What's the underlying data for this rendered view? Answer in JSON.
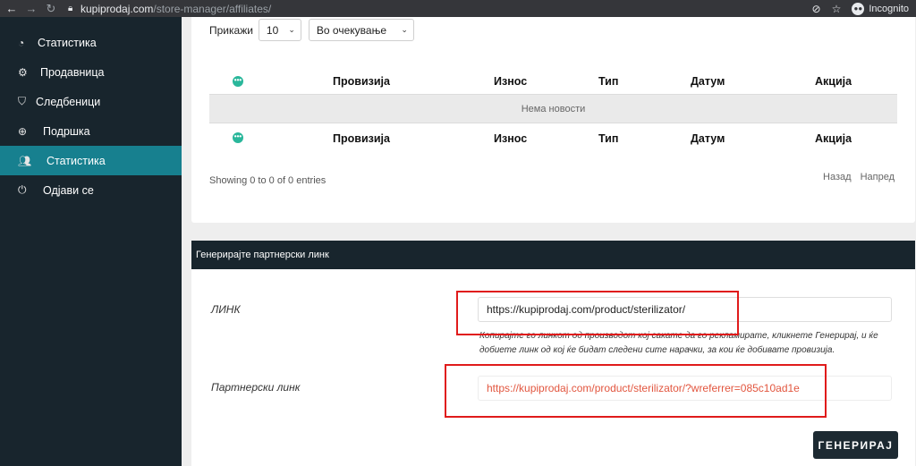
{
  "browser": {
    "url_host": "kupiprodaj.com",
    "url_path": "/store-manager/affiliates/",
    "incognito_label": "Incognito"
  },
  "sidebar": {
    "items": [
      {
        "label": "Статистика",
        "icon": "pie-chart-icon"
      },
      {
        "label": "Продавница",
        "icon": "gears-icon"
      },
      {
        "label": "Следбеници",
        "icon": "shirt-icon"
      },
      {
        "label": "Подршка",
        "icon": "lifebuoy-icon"
      },
      {
        "label": "Статистика",
        "icon": "users-icon",
        "active": true
      },
      {
        "label": "Одјави се",
        "icon": "power-icon"
      }
    ]
  },
  "table": {
    "show_label": "Прикажи",
    "page_size": "10",
    "filter_value": "Во очекување",
    "columns": [
      "Провизија",
      "Износ",
      "Тип",
      "Датум",
      "Акција"
    ],
    "empty_text": "Нема новости",
    "entries_text": "Showing 0 to 0 of 0 entries",
    "prev_label": "Назад",
    "next_label": "Напред"
  },
  "generator": {
    "title": "Генерирајте партнерски линк",
    "link_label": "ЛИНК",
    "link_value": "https://kupiprodaj.com/product/sterilizator/",
    "hint_text": "Копирајте го линкот од производот кој сакате да го рекламирате, кликнете Генерирај, и ќе добиете линк од кој ќе бидат следени сите нарачки, за кои ќе добивате провизија.",
    "partner_label": "Партнерски линк",
    "partner_value": "https://kupiprodaj.com/product/sterilizator/?wreferrer=085c10ad1e",
    "generate_label": "ГЕНЕРИРАЈ"
  },
  "colors": {
    "sidebar_bg": "#18252d",
    "active_item": "#17808f",
    "accent_red": "#e2563f",
    "highlight_box": "#e01b1b"
  }
}
